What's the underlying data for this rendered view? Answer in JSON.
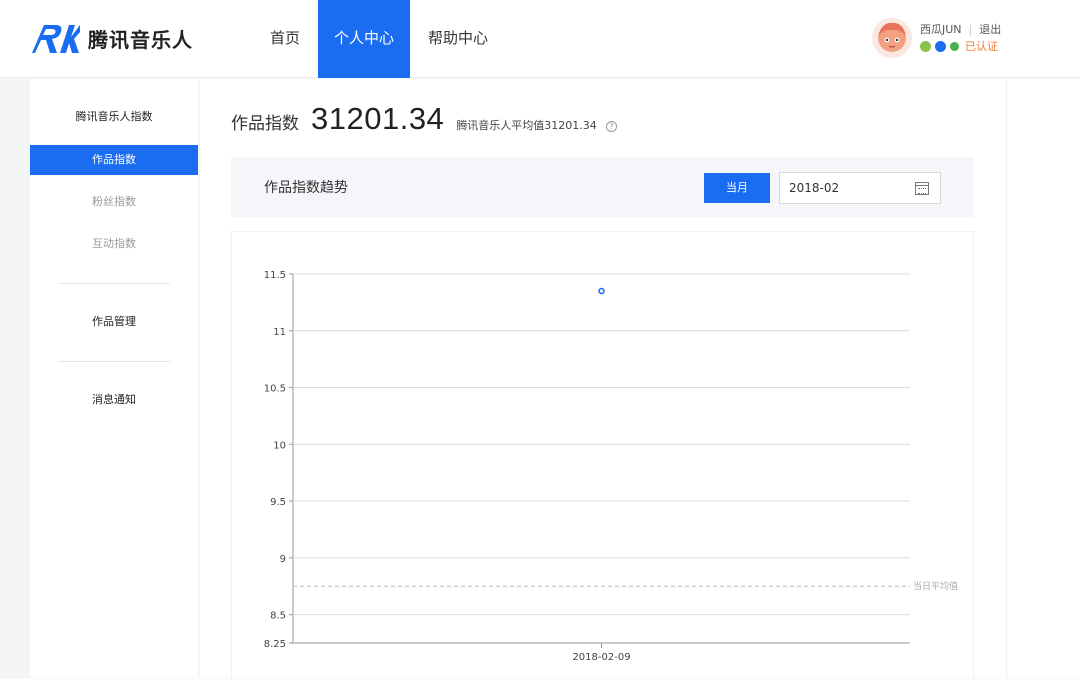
{
  "header": {
    "logo_text": "腾讯音乐人",
    "nav": [
      "首页",
      "个人中心",
      "帮助中心"
    ],
    "nav_active": 1,
    "user": {
      "name": "西瓜JUN",
      "logout": "退出",
      "verified": "已认证",
      "badge_colors": [
        "#8bc34a",
        "#1a6cf0",
        "#4caf50"
      ]
    }
  },
  "sidebar": {
    "section_title": "腾讯音乐人指数",
    "items": [
      "作品指数",
      "粉丝指数",
      "互动指数"
    ],
    "active": 0,
    "manage": "作品管理",
    "notify": "消息通知"
  },
  "main": {
    "score_label": "作品指数",
    "score_value": "31201.34",
    "avg_text": "腾讯音乐人平均值31201.34",
    "help_icon": "question-circle-icon",
    "trend_title": "作品指数趋势",
    "month_button": "当月",
    "date_value": "2018-02",
    "calendar_icon": "calendar-icon"
  },
  "colors": {
    "accent": "#1a6cf0",
    "grid": "#dcdcdc",
    "point": "#1a6cf0",
    "avg_line": "#bbbbbb"
  },
  "chart_data": {
    "type": "scatter",
    "x": [
      "2018-02-09"
    ],
    "y": [
      11.35
    ],
    "y_ticks": [
      11.5,
      11,
      10.5,
      10,
      9.5,
      9,
      8.5,
      8.25
    ],
    "ylim": [
      8.25,
      11.5
    ],
    "avg_line": {
      "value": 8.75,
      "label": "当日平均值"
    },
    "grid": true
  }
}
